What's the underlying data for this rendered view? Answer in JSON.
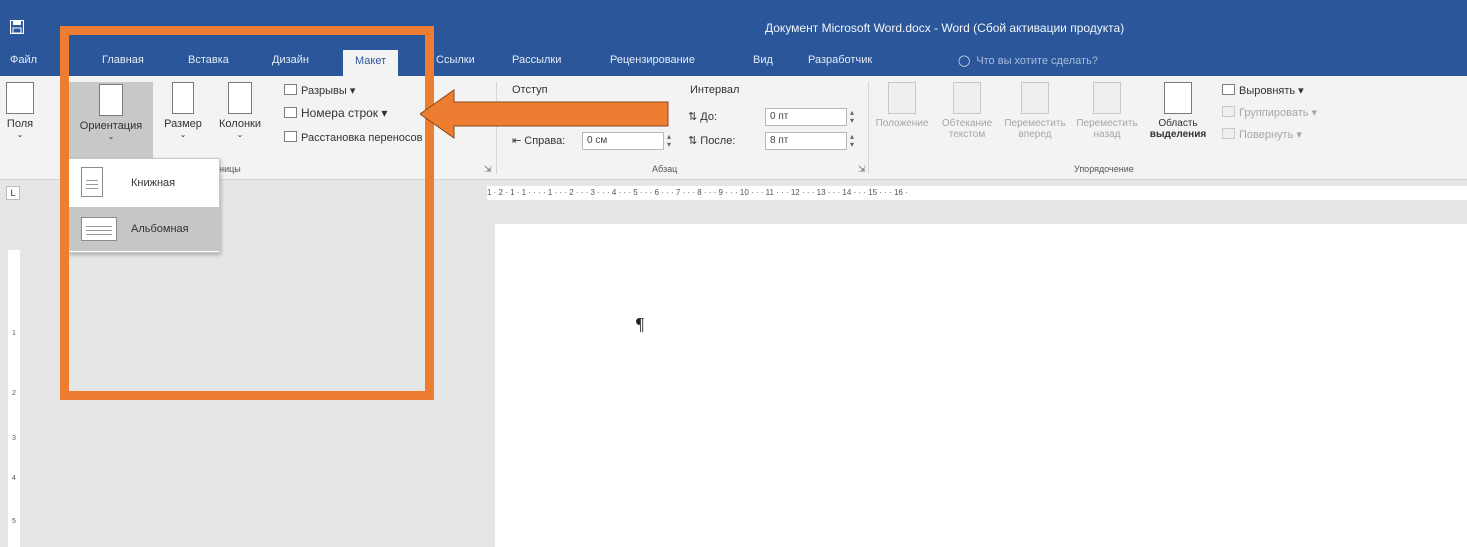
{
  "window": {
    "title": "Документ Microsoft Word.docx  -  Word (Сбой активации продукта)"
  },
  "tabs": [
    {
      "label": "Файл",
      "active": false
    },
    {
      "label": "Главная",
      "active": false
    },
    {
      "label": "Вставка",
      "active": false
    },
    {
      "label": "Дизайн",
      "active": false
    },
    {
      "label": "Макет",
      "active": true
    },
    {
      "label": "Ссылки",
      "active": false
    },
    {
      "label": "Рассылки",
      "active": false
    },
    {
      "label": "Рецензирование",
      "active": false
    },
    {
      "label": "Вид",
      "active": false
    },
    {
      "label": "Разработчик",
      "active": false
    }
  ],
  "tell_me": "Что вы хотите сделать?",
  "ribbon": {
    "page_setup": {
      "fields": "Поля",
      "orientation": "Ориентация",
      "size": "Размер",
      "columns": "Колонки",
      "breaks": "Разрывы",
      "line_numbers": "Номера строк",
      "hyphenation": "Расстановка переносов",
      "group_label": "Параметры страницы"
    },
    "paragraph": {
      "indent_label": "Отступ",
      "spacing_label": "Интервал",
      "right_label": "Справа:",
      "right_value": "0 см",
      "before_label": "До:",
      "before_value": "0 пт",
      "after_label": "После:",
      "after_value": "8 пт",
      "group_label": "Абзац"
    },
    "arrange": {
      "position": "Положение",
      "wrap_text_1": "Обтекание",
      "wrap_text_2": "текстом",
      "bring_forward_1": "Переместить",
      "bring_forward_2": "вперед",
      "send_backward_1": "Переместить",
      "send_backward_2": "назад",
      "selection_pane_1": "Область",
      "selection_pane_2": "выделения",
      "align": "Выровнять",
      "group": "Группировать",
      "rotate": "Повернуть",
      "group_label": "Упорядочение"
    }
  },
  "orientation_menu": {
    "items": [
      {
        "label": "Книжная",
        "highlighted": false
      },
      {
        "label": "Альбомная",
        "highlighted": true
      }
    ]
  },
  "ruler": {
    "corner": "L",
    "top_text": "1 · 2 · 1 · 1 · · · · 1 · · · 2 · · · 3 · · · 4 · · · 5 · · · 6 · · · 7 · · · 8 · · · 9 · · · 10 · · · 11 · · · 12 · · · 13 · · · 14 · · · 15 · · · 16 ·",
    "left_numbers": [
      "1",
      "2",
      "3",
      "4",
      "5"
    ]
  },
  "document": {
    "paragraph_mark": "¶"
  },
  "colors": {
    "accent": "#2b579a",
    "annotation": "#ed7d31",
    "menu_highlight": "#c6c6c6"
  },
  "icons": [
    "save-icon",
    "lightbulb-icon",
    "margins-icon",
    "orientation-icon",
    "size-icon",
    "columns-icon",
    "breaks-icon",
    "line-numbers-icon",
    "hyphenation-icon",
    "portrait-icon",
    "landscape-icon",
    "annotation-arrow-icon"
  ]
}
